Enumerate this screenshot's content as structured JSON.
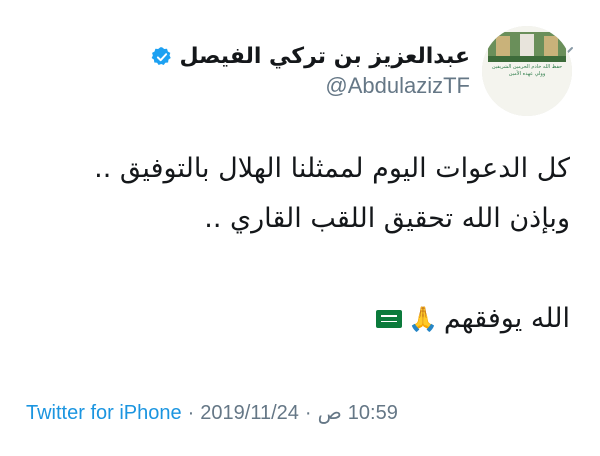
{
  "tweet": {
    "author": {
      "name": "عبدالعزيز بن تركي الفيصل",
      "handle": "@AbdulazizTF",
      "verified_icon": "verified-badge-icon",
      "avatar_text": [
        "حفظ الله خادم الحرمين الشريفين",
        "وولي عهده الأمين"
      ]
    },
    "body": {
      "line1": "كل الدعوات اليوم لممثلنا الهلال بالتوفيق ..",
      "line2": "وبإذن الله تحقيق اللقب القاري ..",
      "line3": "الله يوفقهم",
      "pray_emoji": "🙏",
      "flag_icon": "saudi-flag-icon"
    },
    "meta": {
      "time": "10:59",
      "ampm": "ص",
      "date": "2019/11/24",
      "source": "Twitter for iPhone",
      "separator": "·"
    },
    "colors": {
      "link_blue": "#1b95e0",
      "meta_gray": "#657786",
      "text": "#14171a",
      "verified": "#1da1f2",
      "flag_green": "#0b7a3b"
    }
  }
}
